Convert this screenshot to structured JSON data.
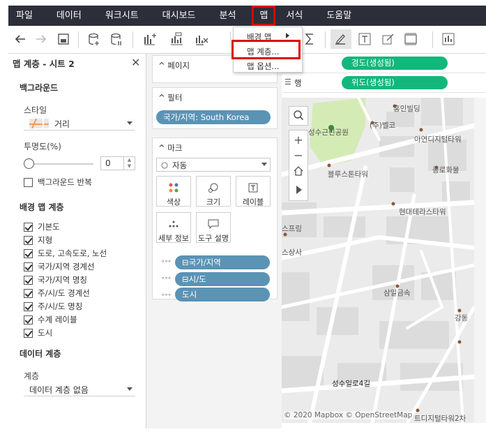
{
  "menubar": {
    "items": [
      "파일",
      "데이터",
      "워크시트",
      "대시보드",
      "분석",
      "맵",
      "서식",
      "도움말"
    ],
    "active_index": 5
  },
  "map_menu": {
    "items": [
      {
        "label": "배경 맵",
        "has_submenu": true
      },
      {
        "label": "맵 계층...",
        "highlighted": true
      },
      {
        "label": "맵 옵션..."
      }
    ]
  },
  "left_panel": {
    "title": "맵 계층 - 시트 2",
    "background_heading": "백그라운드",
    "style_label": "스타일",
    "style_value": "거리",
    "opacity_label": "투명도(%)",
    "opacity_value": "0",
    "repeat_background_label": "백그라운드 반복",
    "repeat_background_checked": false,
    "background_layers_heading": "배경 맵 계층",
    "layers": [
      {
        "label": "기본도",
        "checked": true
      },
      {
        "label": "지형",
        "checked": true
      },
      {
        "label": "도로, 고속도로, 노선",
        "checked": true
      },
      {
        "label": "국가/지역 경계선",
        "checked": true
      },
      {
        "label": "국가/지역 명칭",
        "checked": true
      },
      {
        "label": "주/시/도 경계선",
        "checked": true
      },
      {
        "label": "주/시/도 명칭",
        "checked": true
      },
      {
        "label": "수계 레이블",
        "checked": true
      },
      {
        "label": "도시",
        "checked": true
      }
    ],
    "data_layer_heading": "데이터 계층",
    "layer_label": "계층",
    "layer_value": "데이터 계층 없음"
  },
  "pages_card": {
    "label": "페이지"
  },
  "filters_card": {
    "label": "필터",
    "pill": "국가/지역: South Korea"
  },
  "marks_card": {
    "label": "마크",
    "type_value": "자동",
    "buttons": [
      "색상",
      "크기",
      "레이블",
      "세부 정보",
      "도구 설명"
    ],
    "fields": [
      "⊟국가/지역",
      "⊟시/도",
      "도시"
    ]
  },
  "shelves": {
    "columns_pill": "경도(생성됨)",
    "rows_label": "행",
    "rows_pill": "위도(생성됨)"
  },
  "map": {
    "labels": [
      "홍인빌딩",
      "성수근린공원",
      "(주)벨코",
      "아연디지털타워",
      "블루스톤타워",
      "종로화물",
      "현대테라스타워",
      "스프링",
      "스상사",
      "삼일금속",
      "강동",
      "성수일로4길",
      "트디지털타워2차"
    ],
    "attribution": "© 2020 Mapbox © OpenStreetMap",
    "park_color": "#d4ebb5",
    "building_color": "#dcdcdc",
    "road_color": "#ffffff"
  },
  "colors": {
    "menubar_bg": "#2c2f3a",
    "highlight": "#e00000",
    "field_pill": "#5b93b5",
    "shelf_pill": "#13b77c"
  }
}
